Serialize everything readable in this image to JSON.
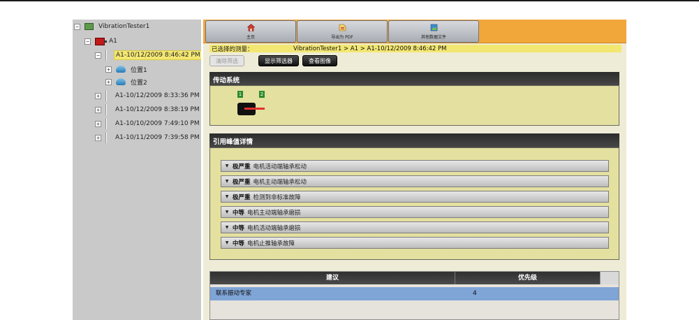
{
  "tree": {
    "root_label": "VibrationTester1",
    "machine_label": "A1",
    "selected_measurement": "A1-10/12/2009 8:46:42 PM",
    "locations": [
      "位置1",
      "位置2"
    ],
    "other_measurements": [
      "A1-10/12/2009 8:33:36 PM",
      "A1-10/12/2009 8:38:19 PM",
      "A1-10/10/2009 7:49:10 PM",
      "A1-10/11/2009 7:39:58 PM"
    ],
    "expand_collapsed": "+",
    "expand_expanded": "−"
  },
  "toolbar": {
    "home_label": "主页",
    "export_label": "导出为 PDF",
    "other_files_label": "其他数据文件",
    "accent": "#f2a73b"
  },
  "breadcrumb": {
    "label": "已选择的测量：",
    "path": "VibrationTester1 > A1 > A1-10/12/2009 8:46:42 PM"
  },
  "filters": {
    "clear_label": "清除筛选",
    "show_label": "显示筛选器",
    "view_image_label": "查看图像"
  },
  "drive_system": {
    "title": "传动系统",
    "badges": [
      "1",
      "2"
    ]
  },
  "faults": {
    "title": "引用峰值详情",
    "items": [
      {
        "severity": "极严重",
        "text": "电机活动端轴承松动"
      },
      {
        "severity": "极严重",
        "text": "电机主动端轴承松动"
      },
      {
        "severity": "极严重",
        "text": "检测到非标准故障"
      },
      {
        "severity": "中等",
        "text": "电机主动端轴承磨损"
      },
      {
        "severity": "中等",
        "text": "电机活动端轴承磨损"
      },
      {
        "severity": "中等",
        "text": "电机止推轴承故障"
      }
    ]
  },
  "recommendations": {
    "col_advice": "建议",
    "col_priority": "优先级",
    "rows": [
      {
        "advice": "联系振动专家",
        "priority": "4"
      }
    ]
  }
}
